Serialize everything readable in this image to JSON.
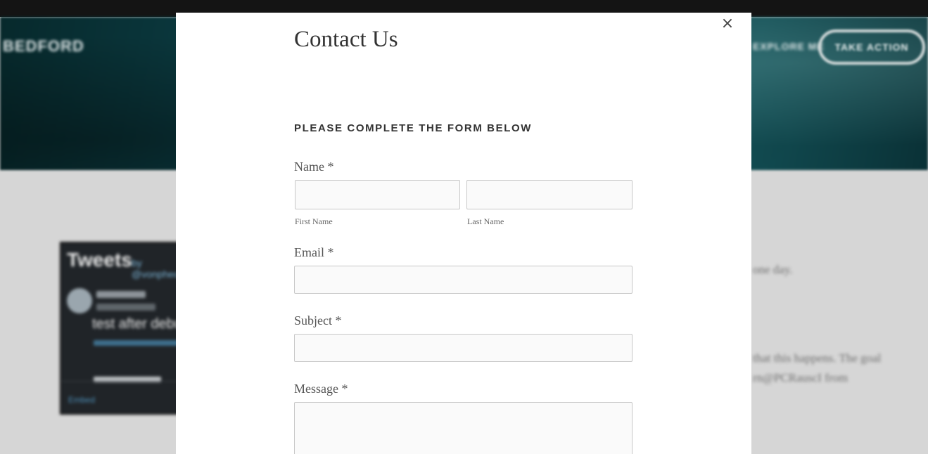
{
  "background": {
    "logo": "BEDFORD",
    "nav_link": "EXPLORE ME",
    "nav_button": "TAKE ACTION",
    "tweets_title": "Tweets",
    "tweets_by": "by @vonpheonix",
    "tweet_text": "test after debug",
    "tweets_embed_link": "Embed",
    "side_text_1": "one day.",
    "side_text_2": "that this happens. The goal",
    "side_text_3": "rn@PCRauscI from"
  },
  "modal": {
    "close_symbol": "×",
    "title": "Contact Us",
    "section_heading": "PLEASE COMPLETE THE FORM BELOW",
    "name": {
      "label": "Name",
      "required_marker": "*",
      "first_caption": "First Name",
      "last_caption": "Last Name",
      "first_value": "",
      "last_value": ""
    },
    "email": {
      "label": "Email",
      "required_marker": "*",
      "value": ""
    },
    "subject": {
      "label": "Subject",
      "required_marker": "*",
      "value": ""
    },
    "message": {
      "label": "Message",
      "required_marker": "*",
      "value": ""
    }
  }
}
